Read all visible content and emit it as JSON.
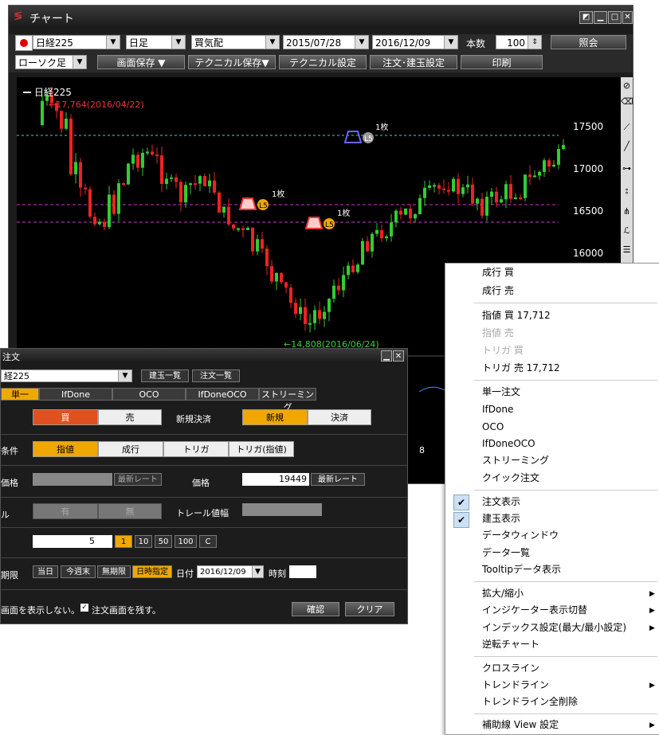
{
  "window": {
    "title": "チャート"
  },
  "toolbar1": {
    "symbol": "日経225",
    "period": "日足",
    "price_type": "買気配",
    "date_from": "2015/07/28",
    "date_to": "2016/12/09",
    "count_label": "本数",
    "count_value": "100",
    "query_button": "照会"
  },
  "toolbar2": {
    "chart_type": "ローソク足",
    "buttons": [
      "画面保存 ▼",
      "テクニカル保存▼",
      "テクニカル設定",
      "注文･建玉設定",
      "印刷"
    ]
  },
  "chart": {
    "legend": "日経225",
    "high_annotation": "←17,764(2016/04/22)",
    "low_annotation": "←14,808(2016/06/24)",
    "y_ticks": [
      "17500",
      "17000",
      "16500",
      "16000"
    ],
    "markers": [
      {
        "qty": "1枚",
        "badge": "L5"
      },
      {
        "qty": "1枚",
        "badge": "L5"
      },
      {
        "qty": "1枚",
        "badge": "L5"
      }
    ],
    "lower_tick": "8"
  },
  "order": {
    "title": "注文",
    "symbol": "経225",
    "btn_positions": "建玉一覧",
    "btn_orders": "注文一覧",
    "tabs": [
      "単一",
      "IfDone",
      "OCO",
      "IfDoneOCO",
      "ストリーミング"
    ],
    "buy": "買",
    "sell": "売",
    "new_settle_label": "新規決済",
    "new": "新規",
    "settle": "決済",
    "cond_label": "条件",
    "cond_opts": [
      "指値",
      "成行",
      "トリガ",
      "トリガ(指値)"
    ],
    "trigger_label": "価格",
    "latest_rate": "最新レート",
    "price_label": "価格",
    "price_value": "19449",
    "latest_rate2": "最新レート",
    "trail_label": "ル",
    "has": "有",
    "none": "無",
    "trail_width_label": "トレール値幅",
    "qty_value": "5",
    "qty_steps": [
      "1",
      "10",
      "50",
      "100",
      "C"
    ],
    "expiry_label": "期限",
    "expiry_opts": [
      "当日",
      "今週末",
      "無期限",
      "日時指定"
    ],
    "date_label": "日付",
    "date_value": "2016/12/09",
    "time_label": "時刻",
    "foot_text": "画面を表示しない。",
    "keep_text": "注文画面を残す。",
    "confirm": "確認",
    "clear": "クリア"
  },
  "menu": {
    "items": [
      {
        "label": "成行 買",
        "disabled": false
      },
      {
        "label": "成行 売",
        "disabled": false
      },
      {
        "label": "指値 買 17,712",
        "disabled": false
      },
      {
        "label": "指値 売",
        "disabled": true
      },
      {
        "label": "トリガ 買",
        "disabled": true
      },
      {
        "label": "トリガ 売 17,712",
        "disabled": false
      },
      {
        "label": "単一注文",
        "disabled": false
      },
      {
        "label": "IfDone",
        "disabled": false
      },
      {
        "label": "OCO",
        "disabled": false
      },
      {
        "label": "IfDoneOCO",
        "disabled": false
      },
      {
        "label": "ストリーミング",
        "disabled": false
      },
      {
        "label": "クイック注文",
        "disabled": false
      },
      {
        "label": "注文表示",
        "checked": true
      },
      {
        "label": "建玉表示",
        "checked": true
      },
      {
        "label": "データウィンドウ"
      },
      {
        "label": "データ一覧"
      },
      {
        "label": "Tooltipデータ表示"
      },
      {
        "label": "拡大/縮小",
        "submenu": true
      },
      {
        "label": "インジケーター表示切替",
        "submenu": true
      },
      {
        "label": "インデックス設定(最大/最小設定)",
        "submenu": true
      },
      {
        "label": "逆転チャート"
      },
      {
        "label": "クロスライン"
      },
      {
        "label": "トレンドライン",
        "submenu": true
      },
      {
        "label": "トレンドライン全削除"
      },
      {
        "label": "補助線 View 設定",
        "submenu": true
      }
    ]
  }
}
